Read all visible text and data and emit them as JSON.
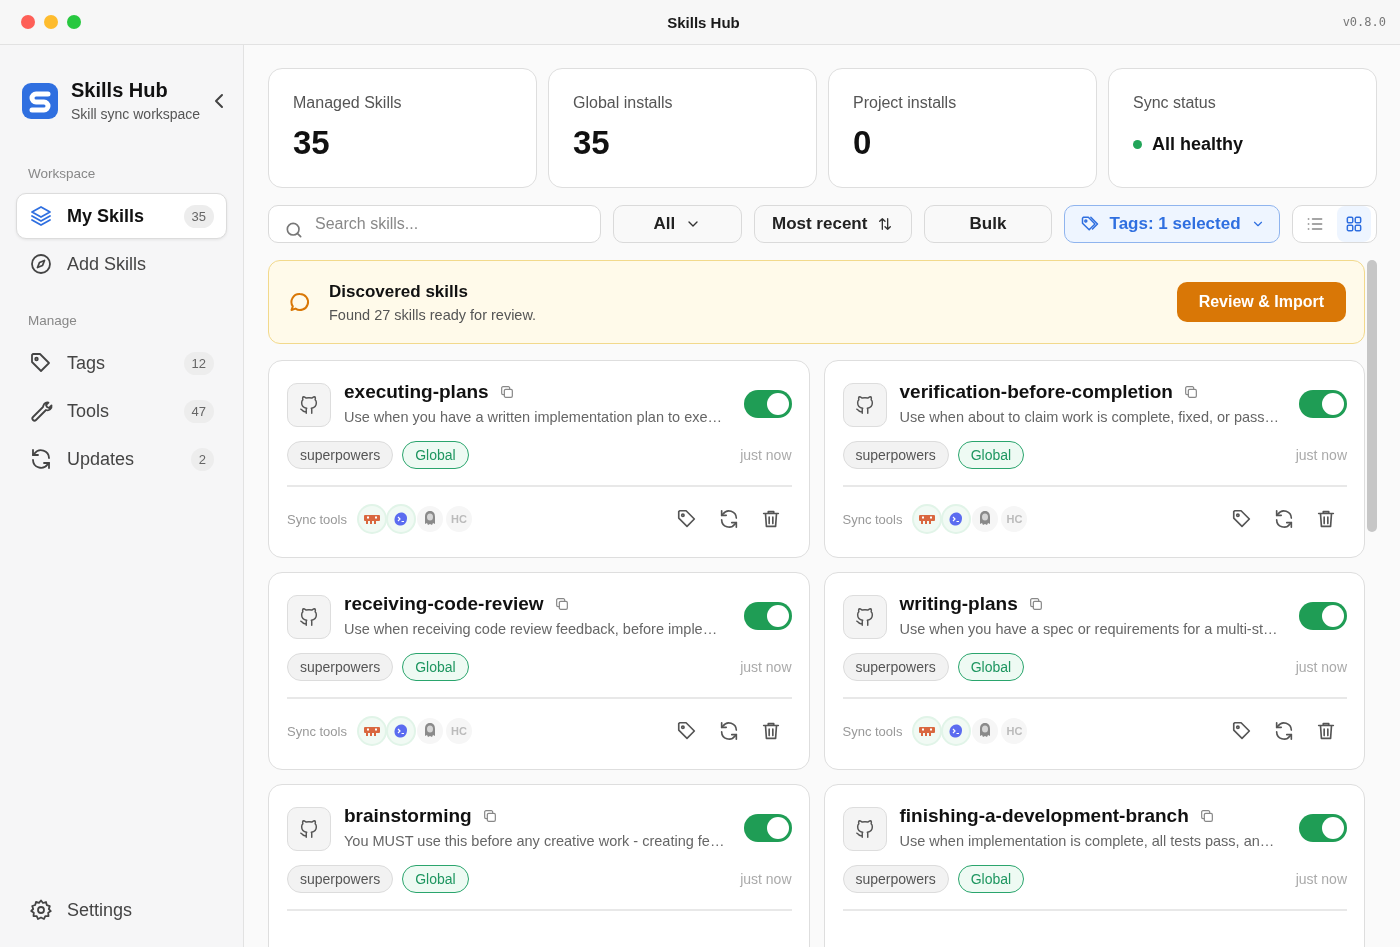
{
  "window": {
    "title": "Skills Hub",
    "version": "v0.8.0"
  },
  "sidebar": {
    "app_name": "Skills Hub",
    "subtitle": "Skill sync workspace",
    "sections": [
      {
        "label": "Workspace",
        "items": [
          {
            "kind": "layers",
            "label": "My Skills",
            "count": "35",
            "selected": true
          },
          {
            "kind": "compass",
            "label": "Add Skills",
            "selected": false
          }
        ]
      },
      {
        "label": "Manage",
        "items": [
          {
            "kind": "tag",
            "label": "Tags",
            "count": "12",
            "selected": false
          },
          {
            "kind": "wrench",
            "label": "Tools",
            "count": "47",
            "selected": false
          },
          {
            "kind": "refresh",
            "label": "Updates",
            "count": "2",
            "selected": false
          }
        ]
      }
    ],
    "footer_item": {
      "kind": "gear",
      "label": "Settings"
    }
  },
  "stats": [
    {
      "kind": "number",
      "label": "Managed Skills",
      "value": "35"
    },
    {
      "kind": "number",
      "label": "Global installs",
      "value": "35"
    },
    {
      "kind": "number",
      "label": "Project installs",
      "value": "0"
    },
    {
      "kind": "status",
      "label": "Sync status",
      "value": "All healthy",
      "color": "#22a559"
    }
  ],
  "toolbar": {
    "search": {
      "placeholder": "Search skills..."
    },
    "scope_filter": "All",
    "sort": "Most recent",
    "bulk": "Bulk",
    "tags_filter": {
      "label": "Tags: 1 selected",
      "active": true
    },
    "view_modes": [
      {
        "kind": "list",
        "selected": false
      },
      {
        "kind": "grid",
        "selected": true
      }
    ]
  },
  "banner": {
    "title": "Discovered skills",
    "message": "Found 27 skills ready for review.",
    "action": "Review & Import"
  },
  "skills": [
    {
      "name": "executing-plans",
      "description": "Use when you have a written implementation plan to exe…",
      "on": true,
      "tags": [
        {
          "kind": "tag",
          "label": "superpowers"
        },
        {
          "kind": "scope",
          "label": "Global"
        }
      ],
      "updated": "just now",
      "sync_label": "Sync tools",
      "sync_tools": [
        {
          "kind": "robot",
          "synced": true
        },
        {
          "kind": "blob",
          "synced": true
        },
        {
          "kind": "figure",
          "synced": false
        },
        {
          "kind": "text",
          "label": "HC",
          "synced": false
        }
      ]
    },
    {
      "name": "verification-before-completion",
      "description": "Use when about to claim work is complete, fixed, or pass…",
      "on": true,
      "tags": [
        {
          "kind": "tag",
          "label": "superpowers"
        },
        {
          "kind": "scope",
          "label": "Global"
        }
      ],
      "updated": "just now",
      "sync_label": "Sync tools",
      "sync_tools": [
        {
          "kind": "robot",
          "synced": true
        },
        {
          "kind": "blob",
          "synced": true
        },
        {
          "kind": "figure",
          "synced": false
        },
        {
          "kind": "text",
          "label": "HC",
          "synced": false
        }
      ]
    },
    {
      "name": "receiving-code-review",
      "description": "Use when receiving code review feedback, before imple…",
      "on": true,
      "tags": [
        {
          "kind": "tag",
          "label": "superpowers"
        },
        {
          "kind": "scope",
          "label": "Global"
        }
      ],
      "updated": "just now",
      "sync_label": "Sync tools",
      "sync_tools": [
        {
          "kind": "robot",
          "synced": true
        },
        {
          "kind": "blob",
          "synced": true
        },
        {
          "kind": "figure",
          "synced": false
        },
        {
          "kind": "text",
          "label": "HC",
          "synced": false
        }
      ]
    },
    {
      "name": "writing-plans",
      "description": "Use when you have a spec or requirements for a multi-st…",
      "on": true,
      "tags": [
        {
          "kind": "tag",
          "label": "superpowers"
        },
        {
          "kind": "scope",
          "label": "Global"
        }
      ],
      "updated": "just now",
      "sync_label": "Sync tools",
      "sync_tools": [
        {
          "kind": "robot",
          "synced": true
        },
        {
          "kind": "blob",
          "synced": true
        },
        {
          "kind": "figure",
          "synced": false
        },
        {
          "kind": "text",
          "label": "HC",
          "synced": false
        }
      ]
    },
    {
      "name": "brainstorming",
      "description": "You MUST use this before any creative work - creating fe…",
      "on": true,
      "tags": [
        {
          "kind": "tag",
          "label": "superpowers"
        },
        {
          "kind": "scope",
          "label": "Global"
        }
      ],
      "updated": "just now"
    },
    {
      "name": "finishing-a-development-branch",
      "description": "Use when implementation is complete, all tests pass, an…",
      "on": true,
      "tags": [
        {
          "kind": "tag",
          "label": "superpowers"
        },
        {
          "kind": "scope",
          "label": "Global"
        }
      ],
      "updated": "just now"
    }
  ]
}
